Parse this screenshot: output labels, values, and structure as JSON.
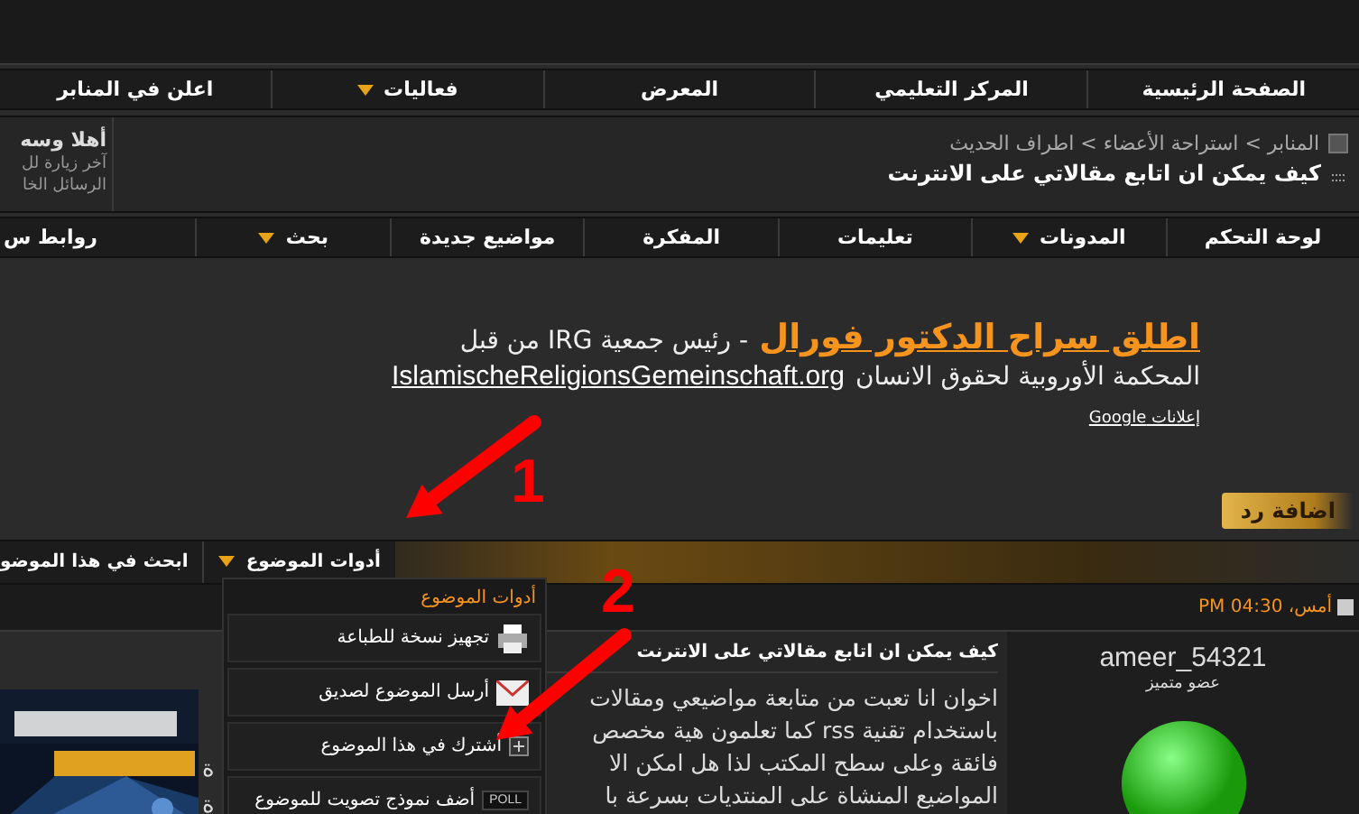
{
  "top_nav": [
    {
      "label": "الصفحة الرئيسية",
      "dropdown": false
    },
    {
      "label": "المركز التعليمي",
      "dropdown": false
    },
    {
      "label": "المعرض",
      "dropdown": false
    },
    {
      "label": "فعاليات",
      "dropdown": true
    },
    {
      "label": "اعلن في المنابر",
      "dropdown": false
    }
  ],
  "breadcrumb": {
    "path": "المنابر > استراحة الأعضاء > اطراف الحديث",
    "title": "كيف يمكن ان اتابع مقالاتي على الانترنت"
  },
  "welcome": {
    "greeting": "أهلا وسه",
    "last_visit": "آخر زيارة لل",
    "messages": "الرسائل الخا"
  },
  "sub_nav": [
    {
      "label": "لوحة التحكم",
      "dropdown": false
    },
    {
      "label": "المدونات",
      "dropdown": true
    },
    {
      "label": "تعليمات",
      "dropdown": false
    },
    {
      "label": "المفكرة",
      "dropdown": false
    },
    {
      "label": "مواضيع جديدة",
      "dropdown": false
    },
    {
      "label": "بحث",
      "dropdown": true
    },
    {
      "label": "روابط س",
      "dropdown": false
    }
  ],
  "ad": {
    "headline": "اطلق سراح الدكتور فورال",
    "headline_rest": "- رئيس جمعية IRG من قبل",
    "line2": "المحكمة الأوروبية لحقوق الانسان",
    "link": "IslamischeReligionsGemeinschaft.org",
    "ads_by": "إعلانات Google"
  },
  "reply_button": "اضافة رد",
  "toolbar": [
    {
      "label": "أدوات الموضوع",
      "dropdown": true
    },
    {
      "label": "ابحث في هذا الموضو",
      "dropdown": false
    }
  ],
  "tools_menu": {
    "header": "أدوات الموضوع",
    "items": [
      {
        "kind": "print",
        "label": "تجهيز نسخة للطباعة"
      },
      {
        "kind": "email",
        "label": "أرسل الموضوع لصديق"
      },
      {
        "kind": "subscribe",
        "label": "أشترك في هذا الموضوع"
      },
      {
        "kind": "poll",
        "badge": "POLL",
        "label": "أضف نموذج تصويت للموضوع"
      }
    ]
  },
  "post": {
    "date": "أمس، 04:30 PM",
    "user": "ameer_54321",
    "rank": "عضو متميز",
    "title": "كيف يمكن ان اتابع مقالاتي على الانترنت",
    "lines": [
      "اخوان انا تعبت من متابعة مواضيعي ومقالات",
      "باستخدام تقنية rss كما تعلمون هية مخصص",
      "فائقة وعلى سطح المكتب لذا هل امكن الا",
      "المواضيع المنشاة على المنتديات بسرعة با"
    ]
  },
  "side_post": {
    "kind": "picture",
    "fragments": [
      "ة",
      "ة"
    ]
  },
  "annotations": [
    {
      "label": "1"
    },
    {
      "label": "2"
    }
  ]
}
